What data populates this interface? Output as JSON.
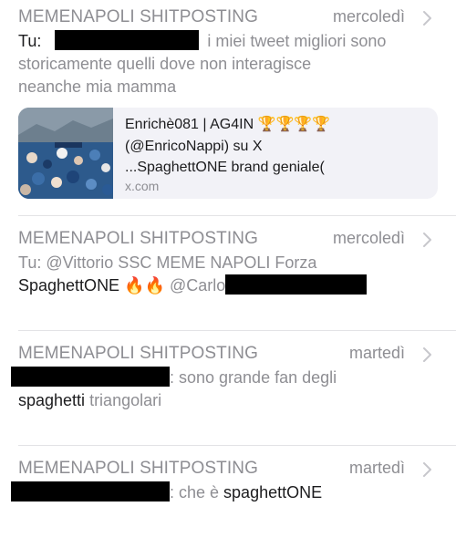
{
  "conversations": [
    {
      "sender": "MEMENAPOLI SHITPOSTING",
      "date": "mercoledì",
      "line1_prefix": "Tu:",
      "line1_rest": "i miei tweet migliori sono",
      "line2": "storicamente quelli dove non interagisce",
      "line3": "neanche mia mamma",
      "link_preview": {
        "title_line1": "Enrichè081 | AG4IN 🏆🏆🏆🏆",
        "title_line2": "(@EnricoNappi) su X",
        "description_prefix": "...",
        "description_highlight": "SpaghettONE",
        "description_rest": " brand geniale(",
        "domain": "x.com"
      }
    },
    {
      "sender": "MEMENAPOLI SHITPOSTING",
      "date": "mercoledì",
      "line1": "Tu: @Vittorio SSC MEME NAPOLI Forza",
      "line2_highlight": "SpaghettONE",
      "line2_emoji": "🔥🔥",
      "line2_rest": "@Carlo"
    },
    {
      "sender": "MEMENAPOLI SHITPOSTING",
      "date": "martedì",
      "line1_rest": ": sono grande fan degli",
      "line2_highlight": "spaghetti",
      "line2_rest": " triangolari"
    },
    {
      "sender": "MEMENAPOLI SHITPOSTING",
      "date": "martedì",
      "line1_rest": ": che è ",
      "line1_highlight": "spaghettONE"
    }
  ],
  "icons": {
    "chevron": "chevron-right-icon"
  },
  "colors": {
    "secondary": "#8e8e93",
    "primary": "#1c1c1e",
    "card_bg": "#f2f2f7",
    "separator": "#e3e3e6"
  }
}
